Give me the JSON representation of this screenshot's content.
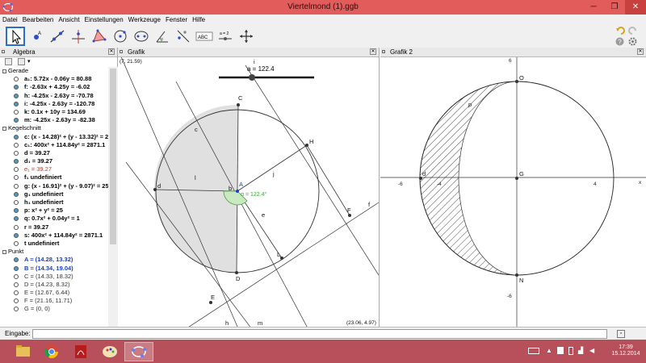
{
  "window": {
    "title": "Viertelmond (1).ggb"
  },
  "menu": [
    "Datei",
    "Bearbeiten",
    "Ansicht",
    "Einstellungen",
    "Werkzeuge",
    "Fenster",
    "Hilfe"
  ],
  "algebra": {
    "title": "Algebra",
    "items": [
      {
        "kind": "cat",
        "text": "Gerade"
      },
      {
        "kind": "item",
        "text": "a₁: 5.72x - 0.06y = 80.88",
        "on": false,
        "color": "#000000"
      },
      {
        "kind": "item",
        "text": "f: -2.63x + 4.25y = -6.02",
        "on": true,
        "color": "#000000"
      },
      {
        "kind": "item",
        "text": "h: -4.25x - 2.63y = -70.78",
        "on": true,
        "color": "#000000"
      },
      {
        "kind": "item",
        "text": "i: -4.25x - 2.63y = -120.78",
        "on": true,
        "color": "#000000"
      },
      {
        "kind": "item",
        "text": "k: 0.1x + 10y = 134.69",
        "on": false,
        "color": "#000000"
      },
      {
        "kind": "item",
        "text": "m: -4.25x - 2.63y = -82.38",
        "on": true,
        "color": "#000000"
      },
      {
        "kind": "cat",
        "text": "Kegelschnitt"
      },
      {
        "kind": "item",
        "text": "c: (x - 14.28)² + (y - 13.32)² = 25",
        "on": true,
        "color": "#000000"
      },
      {
        "kind": "item",
        "text": "c₁: 400x² + 114.84y² = 2871.1",
        "on": false,
        "color": "#000000"
      },
      {
        "kind": "item",
        "text": "d = 39.27",
        "on": false,
        "color": "#000000"
      },
      {
        "kind": "item",
        "text": "d₁ = 39.27",
        "on": true,
        "color": "#000000"
      },
      {
        "kind": "item",
        "text": "e₁ = 39.27",
        "on": false,
        "color": "#c0392b"
      },
      {
        "kind": "item",
        "text": "f₁ undefiniert",
        "on": false,
        "color": "#000000"
      },
      {
        "kind": "item",
        "text": "g: (x - 16.91)² + (y - 9.07)² = 25",
        "on": false,
        "color": "#000000"
      },
      {
        "kind": "item",
        "text": "g₁ undefiniert",
        "on": true,
        "color": "#000000"
      },
      {
        "kind": "item",
        "text": "h₁ undefiniert",
        "on": false,
        "color": "#000000"
      },
      {
        "kind": "item",
        "text": "p: x² + y² = 25",
        "on": true,
        "color": "#000000"
      },
      {
        "kind": "item",
        "text": "q: 0.7x² + 0.04y² = 1",
        "on": true,
        "color": "#000000"
      },
      {
        "kind": "item",
        "text": "r = 39.27",
        "on": false,
        "color": "#000000"
      },
      {
        "kind": "item",
        "text": "s: 400x² + 114.84y² = 2871.1",
        "on": true,
        "color": "#000000"
      },
      {
        "kind": "item",
        "text": "t undefiniert",
        "on": false,
        "color": "#000000"
      },
      {
        "kind": "cat",
        "text": "Punkt"
      },
      {
        "kind": "item",
        "text": "A = (14.28, 13.32)",
        "on": true,
        "color": "#1a3fc9"
      },
      {
        "kind": "item",
        "text": "B = (14.34, 19.04)",
        "on": true,
        "color": "#1a3fc9"
      },
      {
        "kind": "item",
        "text": "C = (14.33, 18.32)",
        "on": false,
        "color": "#333333"
      },
      {
        "kind": "item",
        "text": "D = (14.23, 8.32)",
        "on": false,
        "color": "#333333"
      },
      {
        "kind": "item",
        "text": "E = (12.67, 6.44)",
        "on": false,
        "color": "#333333"
      },
      {
        "kind": "item",
        "text": "F = (21.16, 11.71)",
        "on": false,
        "color": "#333333"
      },
      {
        "kind": "item",
        "text": "G = (0, 0)",
        "on": false,
        "color": "#333333"
      }
    ]
  },
  "graphics1": {
    "title": "Grafik",
    "corner_tl": "(7, 21.59)",
    "corner_br": "(23.06, 4.97)",
    "slider_label": "a = 122.4",
    "angle_label": "α = 122.4°",
    "labels": {
      "C": "C",
      "D": "D",
      "A": "A",
      "B": "B",
      "E": "E",
      "F": "F",
      "H": "H",
      "L": "L",
      "d": "d",
      "c": "c",
      "l": "l",
      "j": "j",
      "e": "e",
      "f": "f",
      "h": "h",
      "m": "m",
      "i": "i",
      "b": "b",
      "alpha": "α"
    }
  },
  "graphics2": {
    "title": "Grafik 2",
    "labels": {
      "O": "O",
      "N": "N",
      "G": "G",
      "d": "d",
      "p": "p"
    },
    "x_ticks": [
      "-6",
      "-4",
      "4"
    ],
    "y_ticks": [
      "6",
      "-6"
    ],
    "axis_x": "x"
  },
  "input": {
    "label": "Eingabe:"
  },
  "taskbar": {
    "time": "17:39",
    "date": "15.12.2014"
  },
  "colors": {
    "titlebar": "#e25c5c",
    "taskbar": "#b7505a",
    "point": "#1a3fc9",
    "angle": "#3ea33e"
  }
}
